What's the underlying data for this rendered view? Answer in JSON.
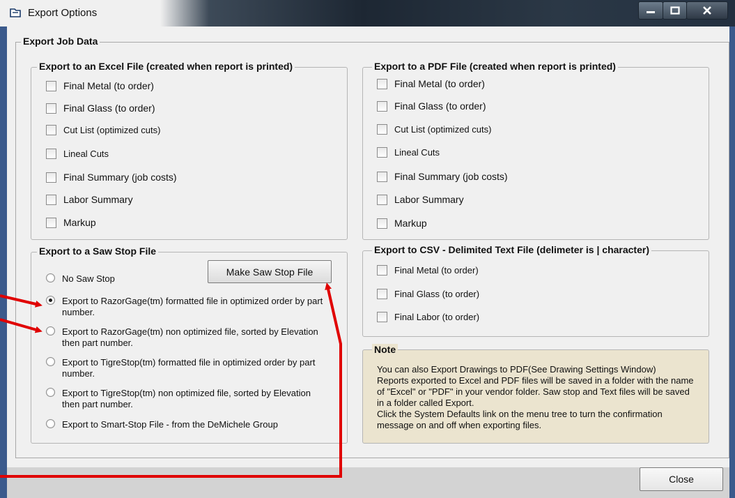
{
  "window": {
    "title": "Export Options",
    "minimize_icon": "minimize-icon",
    "maximize_icon": "maximize-icon",
    "close_icon": "close-icon"
  },
  "outer_group": {
    "title": "Export Job Data"
  },
  "excel": {
    "title": "Export to an Excel File (created when report is printed)",
    "items": [
      {
        "label": "Final Metal (to order)",
        "checked": false
      },
      {
        "label": "Final Glass (to order)",
        "checked": false
      },
      {
        "label": "Cut List (optimized cuts)",
        "checked": false
      },
      {
        "label": "Lineal Cuts",
        "checked": false
      },
      {
        "label": "Final Summary (job costs)",
        "checked": false
      },
      {
        "label": "Labor Summary",
        "checked": false
      },
      {
        "label": "Markup",
        "checked": false
      }
    ]
  },
  "pdf": {
    "title": "Export to a PDF File (created when report is printed)",
    "items": [
      {
        "label": "Final Metal (to order)",
        "checked": false
      },
      {
        "label": "Final Glass (to order)",
        "checked": false
      },
      {
        "label": "Cut List (optimized cuts)",
        "checked": false
      },
      {
        "label": "Lineal Cuts",
        "checked": false
      },
      {
        "label": "Final Summary (job costs)",
        "checked": false
      },
      {
        "label": "Labor Summary",
        "checked": false
      },
      {
        "label": "Markup",
        "checked": false
      }
    ]
  },
  "saw_stop": {
    "title": "Export to a Saw Stop File",
    "make_button": "Make Saw Stop File",
    "options": [
      {
        "label": "No Saw Stop",
        "checked": false
      },
      {
        "label": "Export to RazorGage(tm) formatted file in optimized order by part number.",
        "checked": true
      },
      {
        "label": "Export to RazorGage(tm) non optimized file, sorted by Elevation then part number.",
        "checked": false
      },
      {
        "label": "Export to TigreStop(tm) formatted file in optimized order by part number.",
        "checked": false
      },
      {
        "label": "Export to TigreStop(tm) non optimized file, sorted by Elevation then part number.",
        "checked": false
      },
      {
        "label": "Export to Smart-Stop File - from the DeMichele Group",
        "checked": false
      }
    ]
  },
  "csv": {
    "title": "Export to CSV - Delimited Text File (delimeter is | character)",
    "items": [
      {
        "label": "Final Metal (to order)",
        "checked": false
      },
      {
        "label": "Final Glass (to order)",
        "checked": false
      },
      {
        "label": "Final Labor (to order)",
        "checked": false
      }
    ]
  },
  "note": {
    "title": "Note",
    "lines": [
      "You can also Export Drawings to PDF(See Drawing Settings Window)",
      "Reports exported to Excel and PDF files will be saved in a folder with the name of \"Excel\" or \"PDF\" in your vendor folder. Saw stop and Text files will be saved in a folder called Export.",
      "Click the System Defaults link on the menu tree to turn the confirmation message on and off when exporting files."
    ]
  },
  "footer": {
    "close_button": "Close"
  },
  "colors": {
    "background": "#3b5a8c",
    "dialog": "#f0f0f0",
    "note_background": "#ebe4cf",
    "annotation_arrow": "#e00000"
  }
}
